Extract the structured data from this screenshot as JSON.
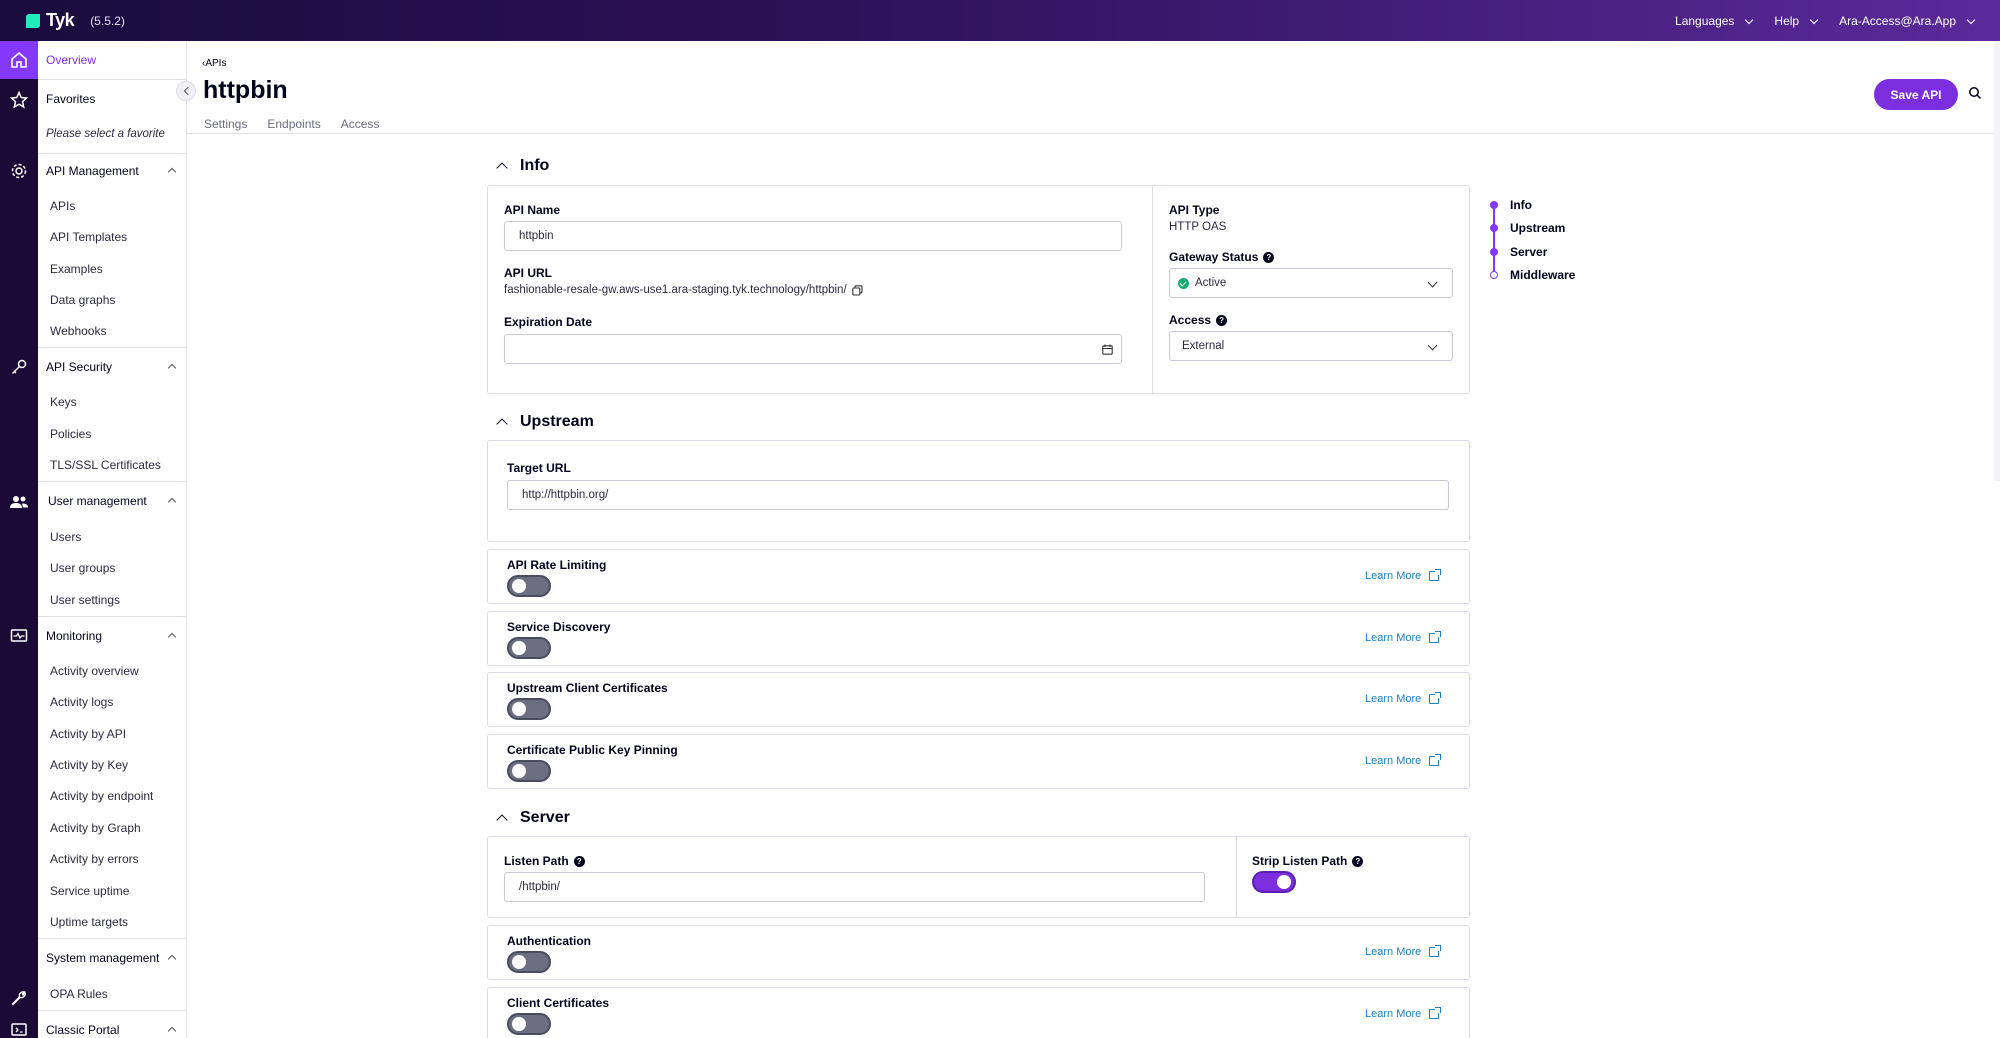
{
  "topbar": {
    "logo": "Tyk",
    "version": "(5.5.2)",
    "menu": {
      "languages": "Languages",
      "help": "Help",
      "account": "Ara-Access@Ara.App"
    }
  },
  "sidebar": {
    "overview": "Overview",
    "favorites": "Favorites",
    "favorites_placeholder": "Please select a favorite",
    "api_management": {
      "label": "API Management",
      "items": [
        "APIs",
        "API Templates",
        "Examples",
        "Data graphs",
        "Webhooks"
      ]
    },
    "api_security": {
      "label": "API Security",
      "items": [
        "Keys",
        "Policies",
        "TLS/SSL Certificates"
      ]
    },
    "user_management": {
      "label": "User management",
      "items": [
        "Users",
        "User groups",
        "User settings"
      ]
    },
    "monitoring": {
      "label": "Monitoring",
      "items": [
        "Activity overview",
        "Activity logs",
        "Activity by API",
        "Activity by Key",
        "Activity by endpoint",
        "Activity by Graph",
        "Activity by errors",
        "Service uptime",
        "Uptime targets"
      ]
    },
    "system_management": {
      "label": "System management",
      "items": [
        "OPA Rules"
      ]
    },
    "classic_portal": {
      "label": "Classic Portal"
    }
  },
  "header": {
    "breadcrumb": "APIs",
    "title": "httpbin",
    "tabs": [
      "Settings",
      "Endpoints",
      "Access"
    ],
    "save_label": "Save API"
  },
  "info": {
    "title": "Info",
    "api_name_label": "API Name",
    "api_name_value": "httpbin",
    "api_url_label": "API URL",
    "api_url_value": "fashionable-resale-gw.aws-use1.ara-staging.tyk.technology/httpbin/",
    "expiration_label": "Expiration Date",
    "expiration_value": "",
    "api_type_label": "API Type",
    "api_type_value": "HTTP OAS",
    "gateway_status_label": "Gateway Status",
    "gateway_status_value": "Active",
    "access_label": "Access",
    "access_value": "External"
  },
  "upstream": {
    "title": "Upstream",
    "target_url_label": "Target URL",
    "target_url_value": "http://httpbin.org/",
    "features": [
      {
        "label": "API Rate Limiting",
        "enabled": false,
        "learn_more": "Learn More"
      },
      {
        "label": "Service Discovery",
        "enabled": false,
        "learn_more": "Learn More"
      },
      {
        "label": "Upstream Client Certificates",
        "enabled": false,
        "learn_more": "Learn More"
      },
      {
        "label": "Certificate Public Key Pinning",
        "enabled": false,
        "learn_more": "Learn More"
      }
    ]
  },
  "server": {
    "title": "Server",
    "listen_path_label": "Listen Path",
    "listen_path_value": "/httpbin/",
    "strip_listen_path_label": "Strip Listen Path",
    "strip_listen_path_enabled": true,
    "features": [
      {
        "label": "Authentication",
        "enabled": false,
        "learn_more": "Learn More"
      },
      {
        "label": "Client Certificates",
        "enabled": false,
        "learn_more": "Learn More"
      }
    ]
  },
  "right_nav": {
    "items": [
      "Info",
      "Upstream",
      "Server",
      "Middleware"
    ]
  },
  "colors": {
    "accent": "#7d2fe0",
    "topbar_dark": "#1a0b3d",
    "link": "#1b7fc4",
    "success": "#19a974"
  }
}
